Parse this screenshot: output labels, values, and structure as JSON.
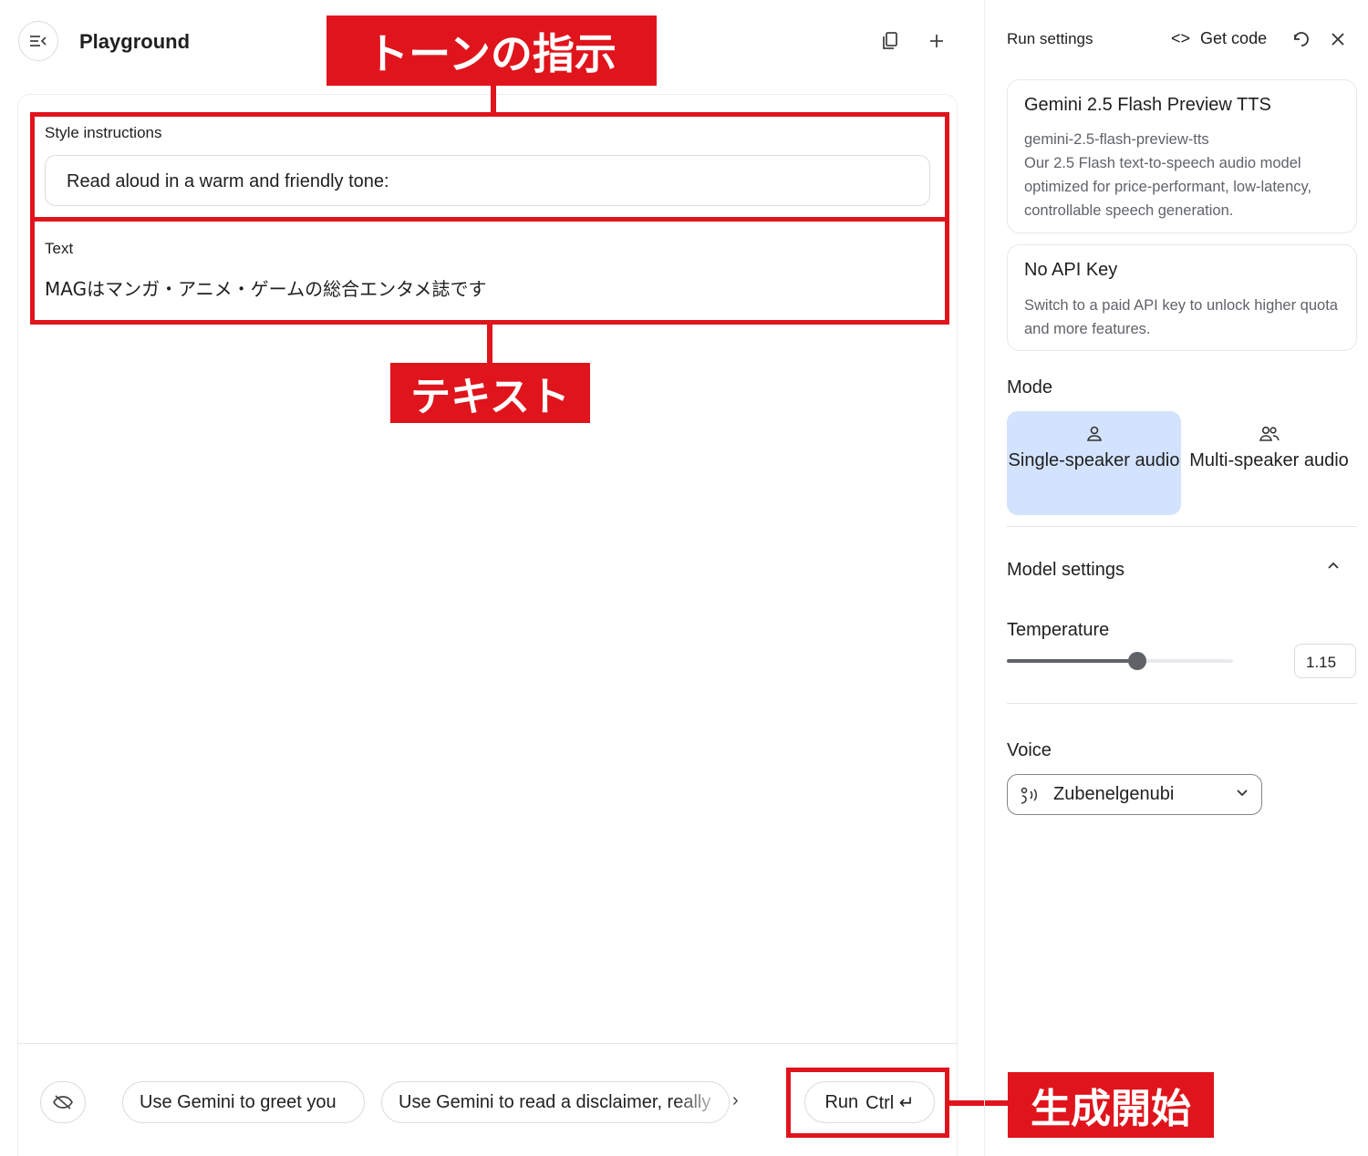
{
  "header": {
    "title": "Playground"
  },
  "editor": {
    "style_label": "Style instructions",
    "style_value": "Read aloud in a warm and friendly tone:",
    "text_label": "Text",
    "text_value": "MAGはマンガ・アニメ・ゲームの総合エンタメ誌です"
  },
  "footer": {
    "suggestions": [
      "Use Gemini to greet you",
      "Use Gemini to read a disclaimer, really"
    ],
    "run_label": "Run",
    "run_shortcut": "Ctrl ↵"
  },
  "annotations": {
    "tone": "トーンの指示",
    "text": "テキスト",
    "start": "生成開始",
    "color": "#e0141c"
  },
  "run_settings": {
    "title": "Run settings",
    "get_code": "Get code",
    "model_card": {
      "title": "Gemini 2.5 Flash Preview TTS",
      "id": "gemini-2.5-flash-preview-tts",
      "description": "Our 2.5 Flash text-to-speech audio model optimized for price-performant, low-latency, controllable speech generation."
    },
    "api_card": {
      "title": "No API Key",
      "description": "Switch to a paid API key to unlock higher quota and more features."
    },
    "mode_label": "Mode",
    "modes": [
      {
        "label": "Single-speaker audio",
        "selected": true
      },
      {
        "label": "Multi-speaker audio",
        "selected": false
      }
    ],
    "model_settings_label": "Model settings",
    "temperature_label": "Temperature",
    "temperature_value": "1.15",
    "temperature_max": 2,
    "voice_label": "Voice",
    "voice_value": "Zubenelgenubi",
    "accent_color": "#d3e3fd"
  }
}
